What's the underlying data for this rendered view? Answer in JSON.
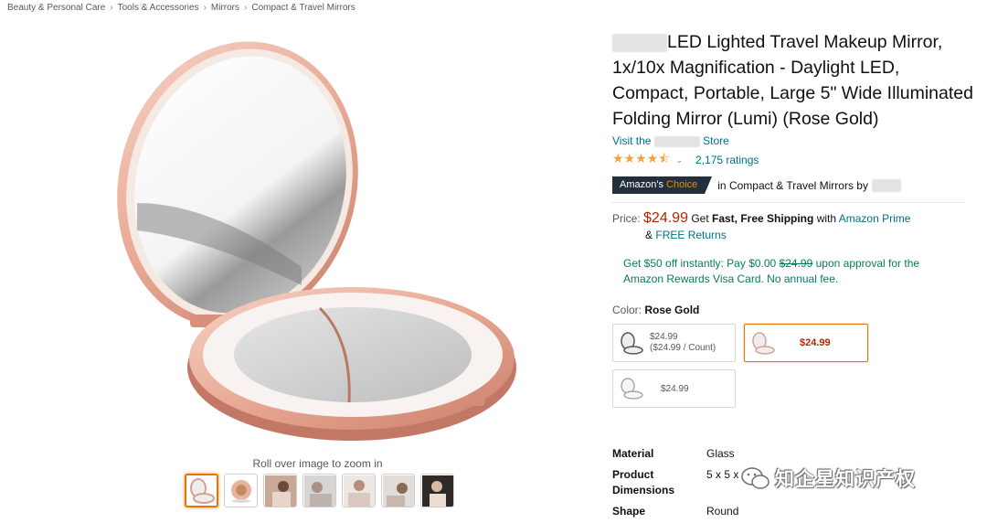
{
  "breadcrumb": [
    "Beauty & Personal Care",
    "Tools & Accessories",
    "Mirrors",
    "Compact & Travel Mirrors"
  ],
  "breadcrumb_separator": "›",
  "gallery": {
    "zoom_hint": "Roll over image to zoom in",
    "thumbnails": [
      "mirror-open",
      "mirror-closed",
      "lifestyle-1",
      "lifestyle-2",
      "lifestyle-3",
      "lifestyle-4",
      "lifestyle-5"
    ],
    "selected_thumbnail": 0
  },
  "product": {
    "title": "LED Lighted Travel Makeup Mirror, 1x/10x Magnification - Daylight LED, Compact, Portable, Large 5\" Wide Illuminated Folding Mirror (Lumi) (Rose Gold)",
    "store_prefix": "Visit the",
    "store_suffix": "Store",
    "rating_stars": 4.5,
    "ratings_text": "2,175 ratings",
    "badge_main": "Amazon's",
    "badge_accent": "Choice",
    "choice_text": "in Compact & Travel Mirrors by"
  },
  "price": {
    "label": "Price:",
    "value": "$24.99",
    "shipping_get": "Get",
    "shipping_bold": "Fast, Free Shipping",
    "shipping_with": "with",
    "prime": "Amazon Prime",
    "returns_amp": "&",
    "returns": "FREE Returns"
  },
  "offer": {
    "text1": "Get $50 off instantly: Pay $0.00",
    "strike": "$24.99",
    "text2": "upon approval for the Amazon Rewards Visa Card. No annual fee."
  },
  "color": {
    "label": "Color:",
    "value": "Rose Gold"
  },
  "swatches": [
    {
      "price": "$24.99",
      "unit": "($24.99 / Count)"
    },
    {
      "price": "$24.99"
    },
    {
      "price": "$24.99"
    }
  ],
  "specs": [
    {
      "key": "Material",
      "value": "Glass"
    },
    {
      "key": "Product Dimensions",
      "value": "5 x 5 x"
    },
    {
      "key": "Shape",
      "value": "Round"
    }
  ],
  "watermark": "知企星知识产权",
  "colors": {
    "link": "#007185",
    "price": "#b12704",
    "offer": "#067d62",
    "badge_bg": "#232f3e",
    "badge_accent": "#f08804",
    "star": "#f1a33a",
    "selected_border": "#e77600"
  }
}
